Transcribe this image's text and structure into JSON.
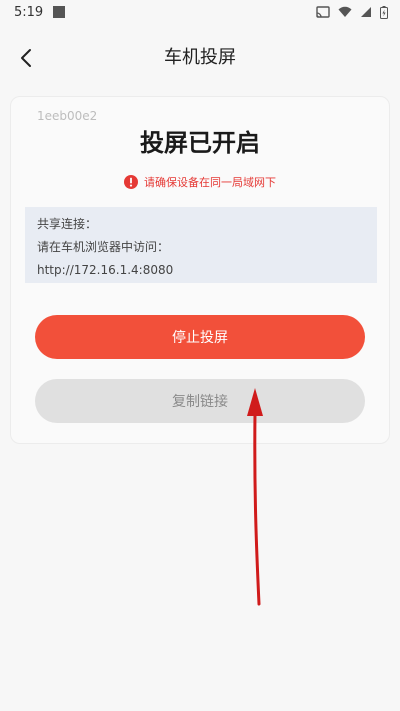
{
  "status_bar": {
    "time": "5:19"
  },
  "header": {
    "title": "车机投屏"
  },
  "card": {
    "device_id": "1eeb00e2",
    "title": "投屏已开启",
    "warning": "请确保设备在同一局域网下",
    "info_lines": [
      "共享连接：",
      "请在车机浏览器中访问：",
      "http://172.16.1.4:8080"
    ],
    "stop_button": "停止投屏",
    "copy_button": "复制链接"
  },
  "colors": {
    "accent": "#f2503a",
    "warning": "#e53935",
    "info_bg": "#e8ecf3",
    "annotation": "#d01b1b"
  }
}
